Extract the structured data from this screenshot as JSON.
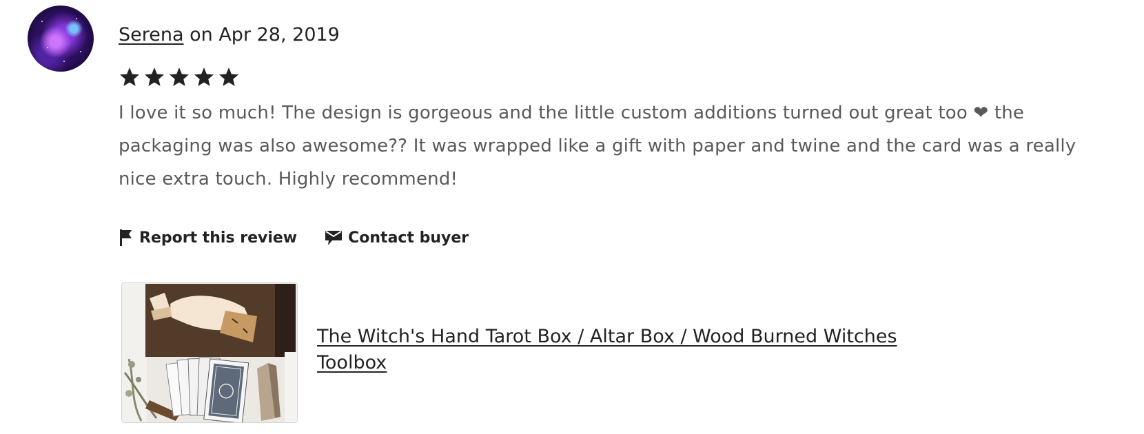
{
  "review": {
    "reviewer_name": "Serena",
    "date_text": "on Apr 28, 2019",
    "rating": 5,
    "rating_max": 5,
    "text": "I love it so much! The design is gorgeous and the little custom additions turned out great too ❤ the packaging was also awesome?? It was wrapped like a gift with paper and twine and the card was a really nice extra touch. Highly recommend!",
    "avatar_icon": "reviewer-avatar"
  },
  "actions": {
    "report_label": "Report this review",
    "report_icon": "flag-icon",
    "contact_label": "Contact buyer",
    "contact_icon": "envelope-icon"
  },
  "listing": {
    "title": "The Witch's Hand Tarot Box / Altar Box / Wood Burned Witches Toolbox",
    "image": "listing-thumbnail"
  },
  "colors": {
    "text_primary": "#222222",
    "text_secondary": "#595959",
    "star": "#222222",
    "background": "#ffffff"
  }
}
